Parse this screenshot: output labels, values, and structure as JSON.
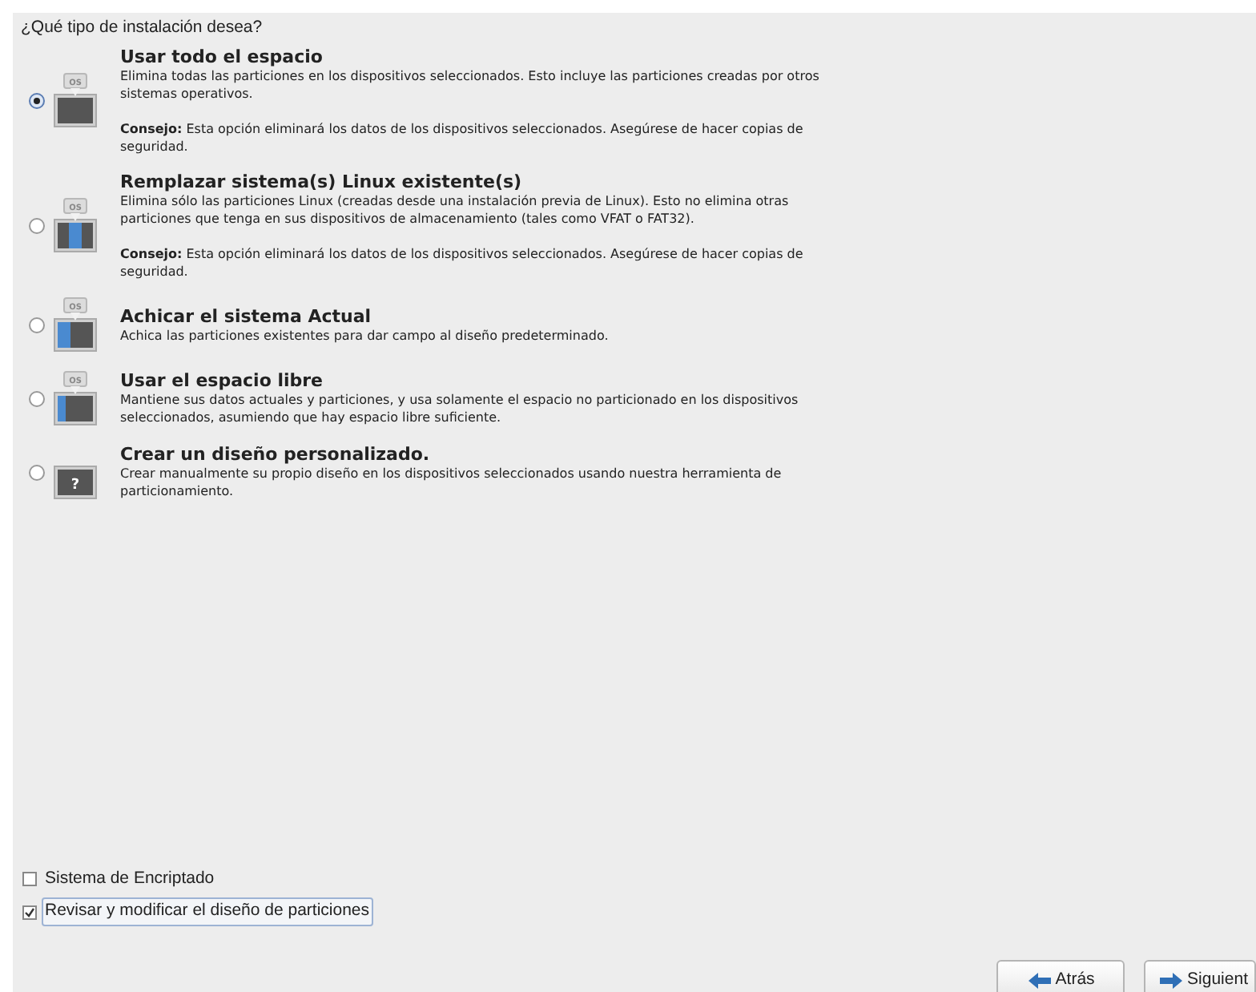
{
  "heading": "¿Qué tipo de instalación desea?",
  "options": [
    {
      "kind": "wipe",
      "icon_label": "OS",
      "title": "Usar todo el espacio",
      "selected": true,
      "description": "Elimina todas las particiones en los dispositivos seleccionados. Esto incluye las particiones creadas por otros sistemas operativos.",
      "tip": "**Consejo:** Esta opción eliminará los datos de los dispositivos seleccionados. Asegúrese de hacer copias de seguridad."
    },
    {
      "kind": "replace",
      "icon_label": "OS",
      "title": "Remplazar sistema(s) Linux existente(s)",
      "selected": false,
      "description": "Elimina sólo las particiones Linux (creadas desde una instalación previa de Linux). Esto no elimina otras particiones que tenga en sus dispositivos de almacenamiento (tales como VFAT o FAT32).",
      "tip": "**Consejo:** Esta opción eliminará los datos de los dispositivos seleccionados. Asegúrese de hacer copias de seguridad."
    },
    {
      "kind": "shrink",
      "icon_label": "OS",
      "title": "Achicar el sistema Actual",
      "selected": false,
      "description": "Achica las particiones existentes para dar campo al diseño predeterminado."
    },
    {
      "kind": "free",
      "icon_label": "OS",
      "title": "Usar el espacio libre",
      "selected": false,
      "description": "Mantiene sus datos actuales y particiones, y usa solamente el espacio no particionado en los dispositivos seleccionados, asumiendo que hay espacio libre suficiente."
    },
    {
      "kind": "custom",
      "icon_label": "?",
      "title": "Crear un diseño personalizado.",
      "selected": false,
      "description": "Crear manualmente su propio diseño en los dispositivos seleccionados usando nuestra herramienta de particionamiento."
    }
  ],
  "checkboxes": [
    {
      "label": "Sistema de Encriptado",
      "checked": false,
      "focused": false
    },
    {
      "label": "Revisar y modificar el diseño de particiones",
      "checked": true,
      "focused": true
    }
  ],
  "buttons": [
    {
      "kind": "back",
      "label": "Atrás"
    },
    {
      "kind": "next",
      "label": "Siguient"
    }
  ]
}
